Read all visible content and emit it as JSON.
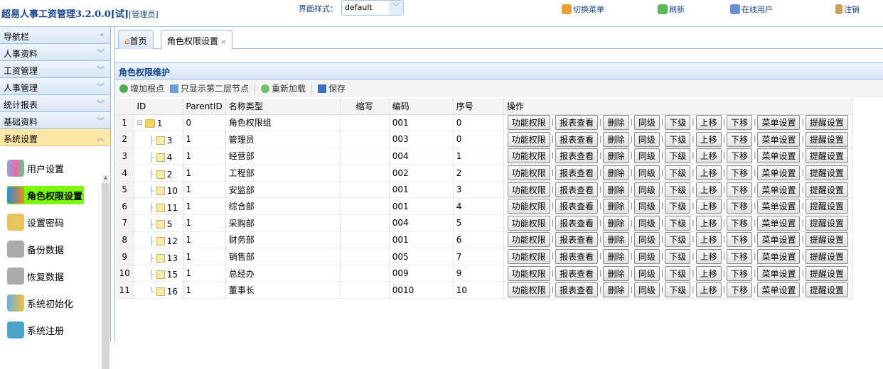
{
  "header": {
    "title": "超易人事工资管理3.2.0.0[试]",
    "role": "[管理员]",
    "theme_label": "界面样式：",
    "theme_value": "default",
    "links": [
      {
        "label": "切换菜单",
        "icon": "switch-menu-icon"
      },
      {
        "label": "刷新",
        "icon": "refresh-icon"
      },
      {
        "label": "在线用户",
        "icon": "online-users-icon"
      },
      {
        "label": "注销",
        "icon": "logout-icon"
      }
    ]
  },
  "sidebar": {
    "title": "导航栏",
    "sections": [
      "人事资料",
      "工资管理",
      "人事管理",
      "统计报表",
      "基础资料",
      "系统设置"
    ],
    "active_section": "系统设置",
    "items": [
      "用户设置",
      "角色权限设置",
      "设置密码",
      "备份数据",
      "恢复数据",
      "系统初始化",
      "系统注册"
    ],
    "selected_item": "角色权限设置"
  },
  "tabs": [
    {
      "label": "首页"
    },
    {
      "label": "角色权限设置"
    }
  ],
  "panel": {
    "title": "角色权限维护",
    "toolbar": [
      "增加根点",
      "只显示第二层节点",
      "重新加载",
      "保存"
    ],
    "columns": [
      "ID",
      "ParentID",
      "名称类型",
      "缩写",
      "编码",
      "序号",
      "操作"
    ],
    "actions": [
      "功能权限",
      "报表查看",
      "删除",
      "同级",
      "下级",
      "上移",
      "下移",
      "菜单设置",
      "提醒设置"
    ],
    "rows": [
      {
        "n": "1",
        "id": "1",
        "parent": "0",
        "name": "角色权限组",
        "abbr": "",
        "code": "001",
        "seq": "0"
      },
      {
        "n": "2",
        "id": "3",
        "parent": "1",
        "name": "管理员",
        "abbr": "",
        "code": "003",
        "seq": "0"
      },
      {
        "n": "3",
        "id": "4",
        "parent": "1",
        "name": "经营部",
        "abbr": "",
        "code": "004",
        "seq": "1"
      },
      {
        "n": "4",
        "id": "2",
        "parent": "1",
        "name": "工程部",
        "abbr": "",
        "code": "002",
        "seq": "2"
      },
      {
        "n": "5",
        "id": "10",
        "parent": "1",
        "name": "安监部",
        "abbr": "",
        "code": "001",
        "seq": "3"
      },
      {
        "n": "6",
        "id": "11",
        "parent": "1",
        "name": "综合部",
        "abbr": "",
        "code": "001",
        "seq": "4"
      },
      {
        "n": "7",
        "id": "5",
        "parent": "1",
        "name": "采购部",
        "abbr": "",
        "code": "004",
        "seq": "5"
      },
      {
        "n": "8",
        "id": "12",
        "parent": "1",
        "name": "财务部",
        "abbr": "",
        "code": "001",
        "seq": "6"
      },
      {
        "n": "9",
        "id": "13",
        "parent": "1",
        "name": "销售部",
        "abbr": "",
        "code": "005",
        "seq": "7"
      },
      {
        "n": "10",
        "id": "15",
        "parent": "1",
        "name": "总经办",
        "abbr": "",
        "code": "009",
        "seq": "9"
      },
      {
        "n": "11",
        "id": "16",
        "parent": "1",
        "name": "董事长",
        "abbr": "",
        "code": "0010",
        "seq": "10"
      }
    ]
  },
  "colors": {
    "accent": "#15428b",
    "border": "#99bbe8",
    "active_section": "#fde8a8",
    "selected_item": "#7cfc00"
  }
}
